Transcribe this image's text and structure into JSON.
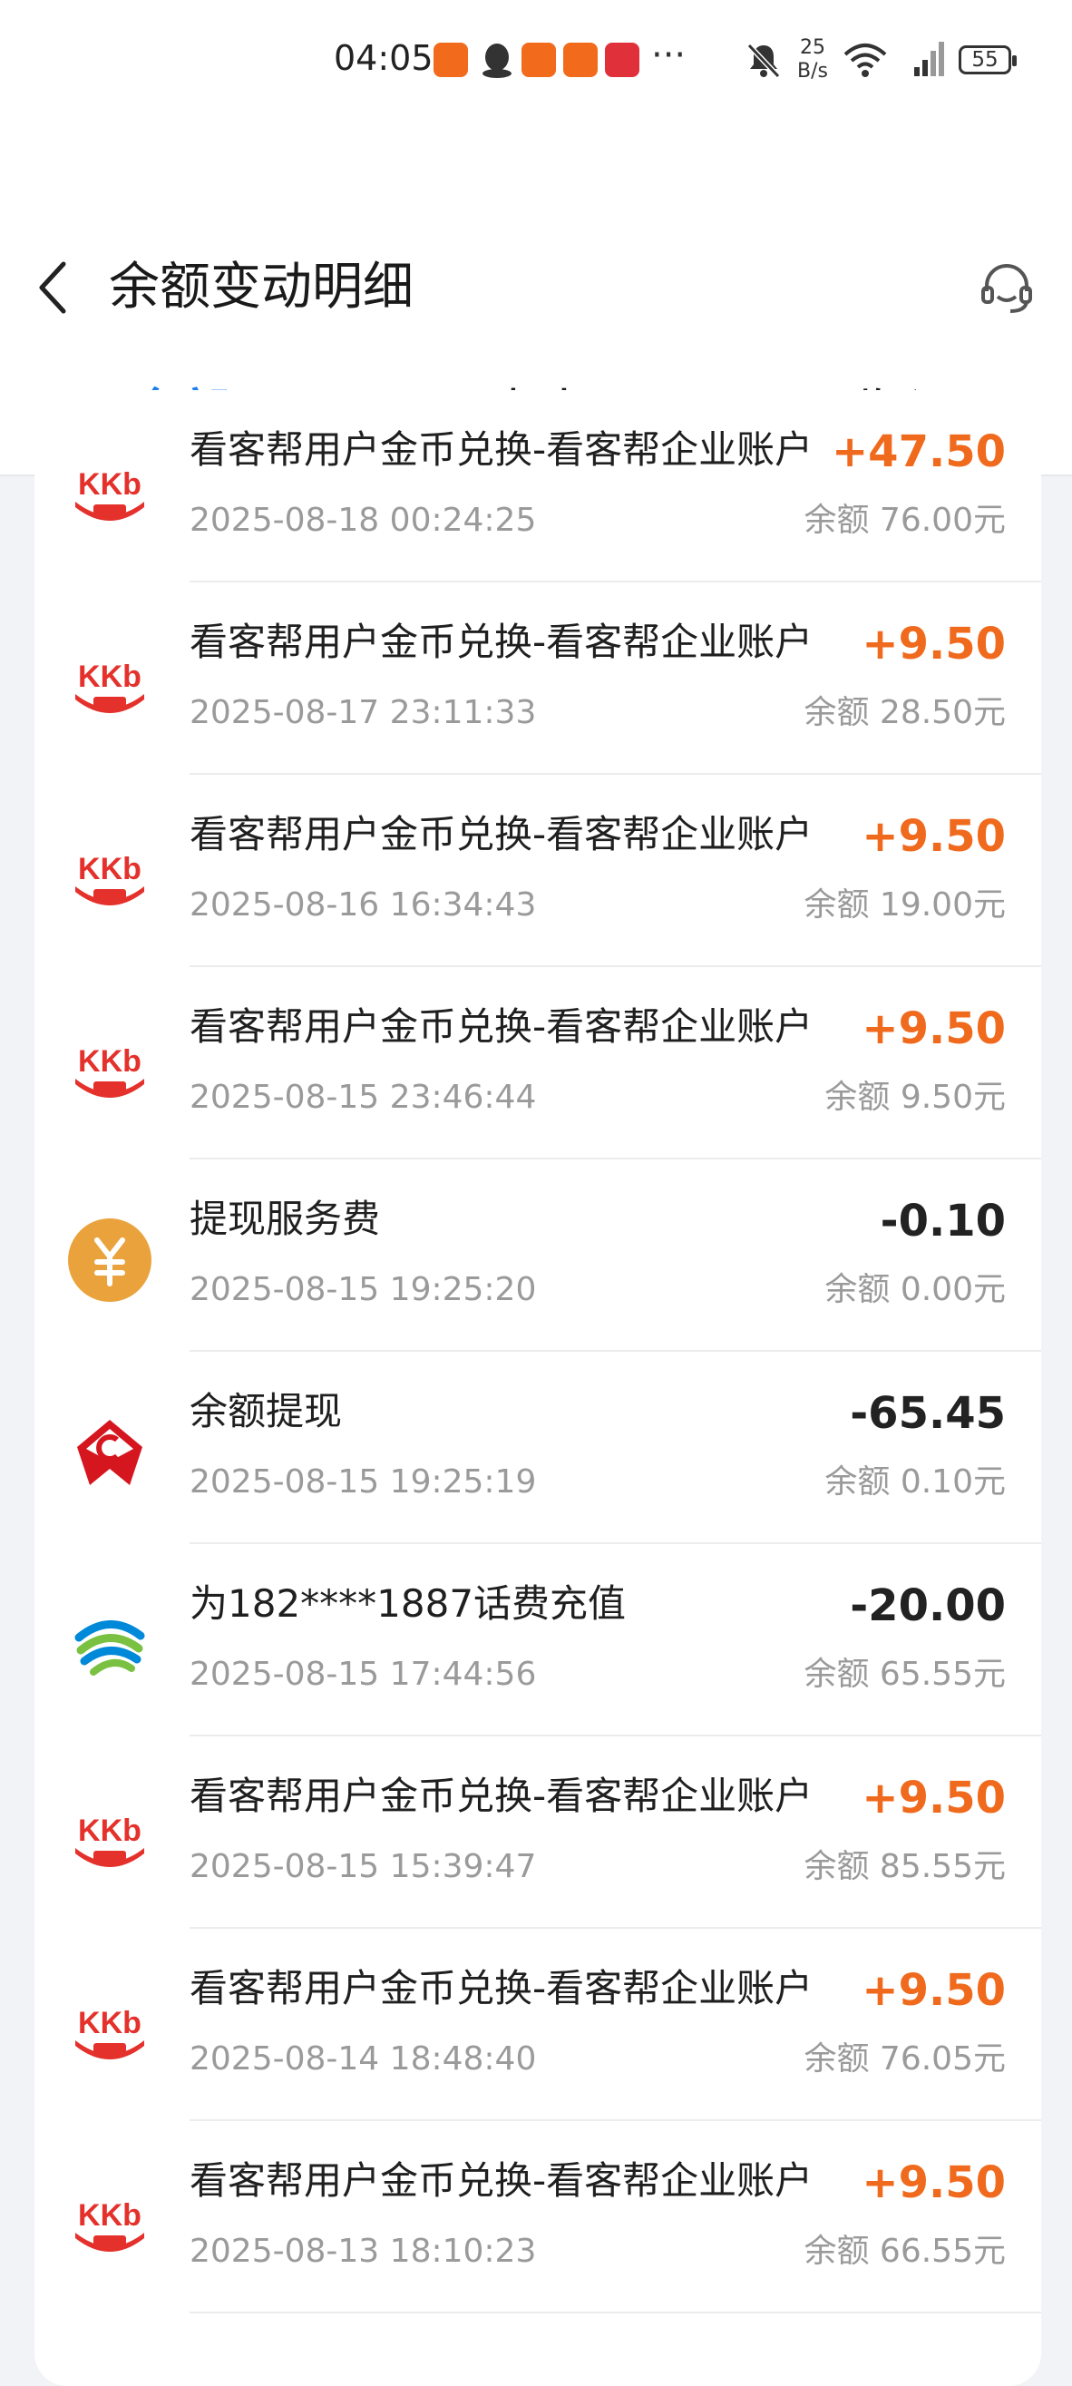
{
  "status_bar": {
    "time": "04:05",
    "more": "···",
    "net_speed_value": "25",
    "net_speed_unit": "B/s",
    "battery": "55",
    "app_icon_colors": [
      "#f26a1b",
      "#f26a1b",
      "#f26a1b",
      "#e0303a"
    ]
  },
  "header": {
    "title": "余额变动明细"
  },
  "tabs": [
    {
      "label": "全部",
      "active": true
    },
    {
      "label": "支出",
      "active": false
    },
    {
      "label": "收入",
      "active": false
    }
  ],
  "colors": {
    "accent": "#1a7cf0",
    "income": "#f06a1e",
    "expense": "#222222",
    "kkb_red": "#e4312b",
    "fee_orange": "#eaa33c"
  },
  "transactions": [
    {
      "icon": "kkb-logo-icon",
      "desc": "看客帮用户金币兑换-看客帮企业账户",
      "amount": "+47.50",
      "type": "income",
      "time": "2025-08-18 00:24:25",
      "balance": "余额 76.00元"
    },
    {
      "icon": "kkb-logo-icon",
      "desc": "看客帮用户金币兑换-看客帮企业账户",
      "amount": "+9.50",
      "type": "income",
      "time": "2025-08-17 23:11:33",
      "balance": "余额 28.50元"
    },
    {
      "icon": "kkb-logo-icon",
      "desc": "看客帮用户金币兑换-看客帮企业账户",
      "amount": "+9.50",
      "type": "income",
      "time": "2025-08-16 16:34:43",
      "balance": "余额 19.00元"
    },
    {
      "icon": "kkb-logo-icon",
      "desc": "看客帮用户金币兑换-看客帮企业账户",
      "amount": "+9.50",
      "type": "income",
      "time": "2025-08-15 23:46:44",
      "balance": "余额 9.50元"
    },
    {
      "icon": "yuan-coin-icon",
      "desc": "提现服务费",
      "amount": "-0.10",
      "type": "expense",
      "time": "2025-08-15 19:25:20",
      "balance": "余额 0.00元"
    },
    {
      "icon": "bank-logo-icon",
      "desc": "余额提现",
      "amount": "-65.45",
      "type": "expense",
      "time": "2025-08-15 19:25:19",
      "balance": "余额 0.10元"
    },
    {
      "icon": "china-mobile-logo-icon",
      "desc": "为182****1887话费充值",
      "amount": "-20.00",
      "type": "expense",
      "time": "2025-08-15 17:44:56",
      "balance": "余额 65.55元"
    },
    {
      "icon": "kkb-logo-icon",
      "desc": "看客帮用户金币兑换-看客帮企业账户",
      "amount": "+9.50",
      "type": "income",
      "time": "2025-08-15 15:39:47",
      "balance": "余额 85.55元"
    },
    {
      "icon": "kkb-logo-icon",
      "desc": "看客帮用户金币兑换-看客帮企业账户",
      "amount": "+9.50",
      "type": "income",
      "time": "2025-08-14 18:48:40",
      "balance": "余额 76.05元"
    },
    {
      "icon": "kkb-logo-icon",
      "desc": "看客帮用户金币兑换-看客帮企业账户",
      "amount": "+9.50",
      "type": "income",
      "time": "2025-08-13 18:10:23",
      "balance": "余额 66.55元"
    }
  ]
}
